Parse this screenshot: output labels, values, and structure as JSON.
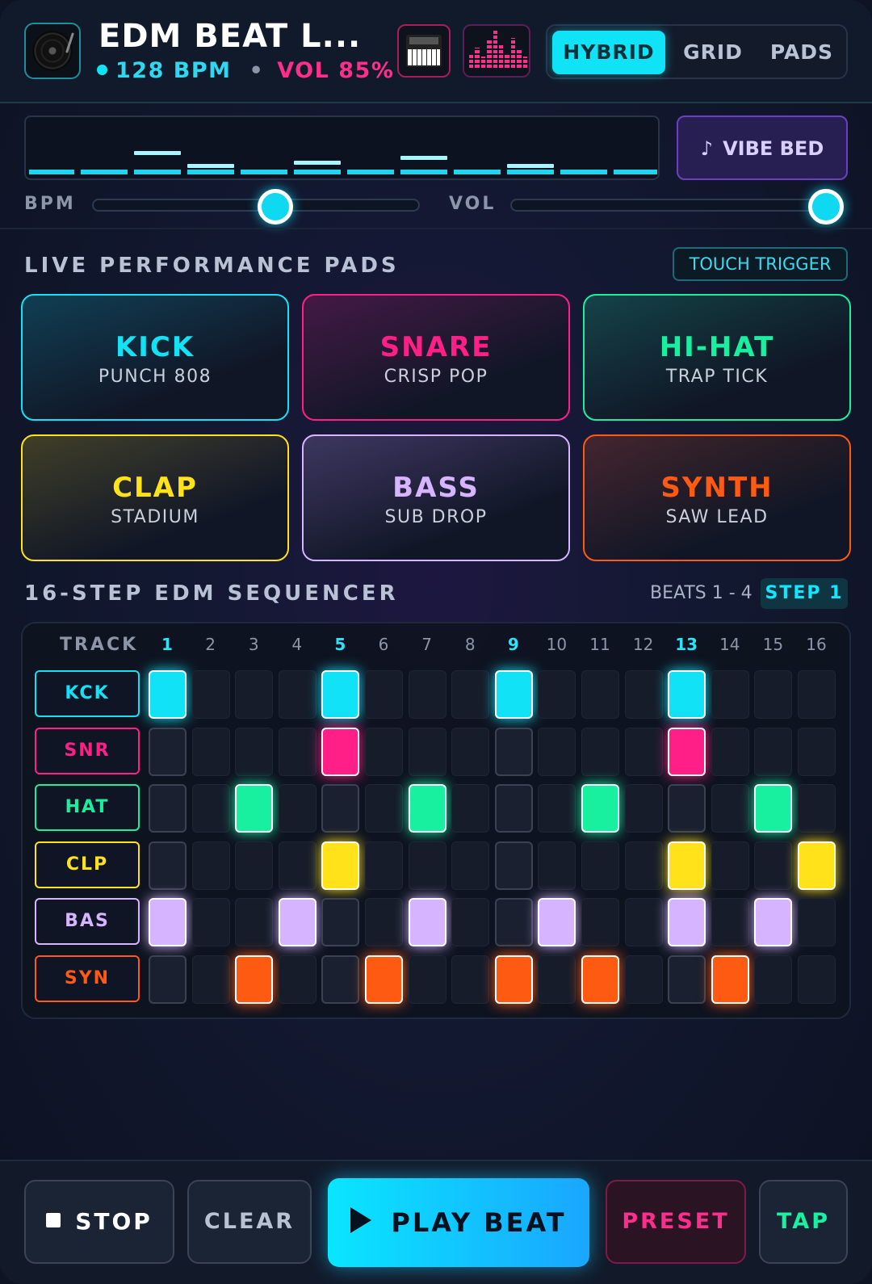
{
  "header": {
    "title": "EDM BEAT L...",
    "bpm_text": "128 BPM",
    "separator": "•",
    "vol_text": "VOL 85%",
    "icons": [
      "turntable-icon",
      "piano-keys-icon",
      "equalizer-icon"
    ],
    "modes": [
      {
        "label": "HYBRID",
        "active": true
      },
      {
        "label": "GRID",
        "active": false
      },
      {
        "label": "PADS",
        "active": false
      }
    ]
  },
  "mixer": {
    "vibe_button": "VIBE BED",
    "vibe_icon": "music-note-icon",
    "bpm_label": "BPM",
    "vol_label": "VOL",
    "bpm_slider_fraction": 0.56,
    "vol_slider_fraction": 0.95
  },
  "pads": {
    "title": "LIVE PERFORMANCE PADS",
    "touch_label": "TOUCH TRIGGER",
    "items": [
      {
        "name": "KICK",
        "sub": "PUNCH 808",
        "color": "#12e2f5"
      },
      {
        "name": "SNARE",
        "sub": "CRISP POP",
        "color": "#ff1f86"
      },
      {
        "name": "HI-HAT",
        "sub": "TRAP TICK",
        "color": "#18f0a0"
      },
      {
        "name": "CLAP",
        "sub": "STADIUM",
        "color": "#ffe21a"
      },
      {
        "name": "BASS",
        "sub": "SUB DROP",
        "color": "#d7b4ff"
      },
      {
        "name": "SYNTH",
        "sub": "SAW LEAD",
        "color": "#ff5a12"
      }
    ]
  },
  "sequencer": {
    "title": "16-STEP EDM SEQUENCER",
    "beats_label": "BEATS 1 - 4",
    "step_label": "STEP 1",
    "track_header": "TRACK",
    "steps": [
      "1",
      "2",
      "3",
      "4",
      "5",
      "6",
      "7",
      "8",
      "9",
      "10",
      "11",
      "12",
      "13",
      "14",
      "15",
      "16"
    ],
    "tracks": [
      {
        "label": "KCK",
        "color": "#12e2f5",
        "pattern": [
          1,
          0,
          0,
          0,
          1,
          0,
          0,
          0,
          1,
          0,
          0,
          0,
          1,
          0,
          0,
          0
        ]
      },
      {
        "label": "SNR",
        "color": "#ff1f86",
        "pattern": [
          0,
          0,
          0,
          0,
          1,
          0,
          0,
          0,
          0,
          0,
          0,
          0,
          1,
          0,
          0,
          0
        ]
      },
      {
        "label": "HAT",
        "color": "#18f0a0",
        "pattern": [
          0,
          0,
          1,
          0,
          0,
          0,
          1,
          0,
          0,
          0,
          1,
          0,
          0,
          0,
          1,
          0
        ]
      },
      {
        "label": "CLP",
        "color": "#ffe21a",
        "pattern": [
          0,
          0,
          0,
          0,
          1,
          0,
          0,
          0,
          0,
          0,
          0,
          0,
          1,
          0,
          0,
          1
        ]
      },
      {
        "label": "BAS",
        "color": "#d7b4ff",
        "pattern": [
          1,
          0,
          0,
          1,
          0,
          0,
          1,
          0,
          0,
          1,
          0,
          0,
          1,
          0,
          1,
          0
        ]
      },
      {
        "label": "SYN",
        "color": "#ff5a12",
        "pattern": [
          0,
          0,
          1,
          0,
          0,
          1,
          0,
          0,
          1,
          0,
          1,
          0,
          0,
          1,
          0,
          0
        ]
      }
    ]
  },
  "transport": {
    "stop": "STOP",
    "clear": "CLEAR",
    "play": "PLAY BEAT",
    "preset": "PRESET",
    "tap": "TAP"
  }
}
